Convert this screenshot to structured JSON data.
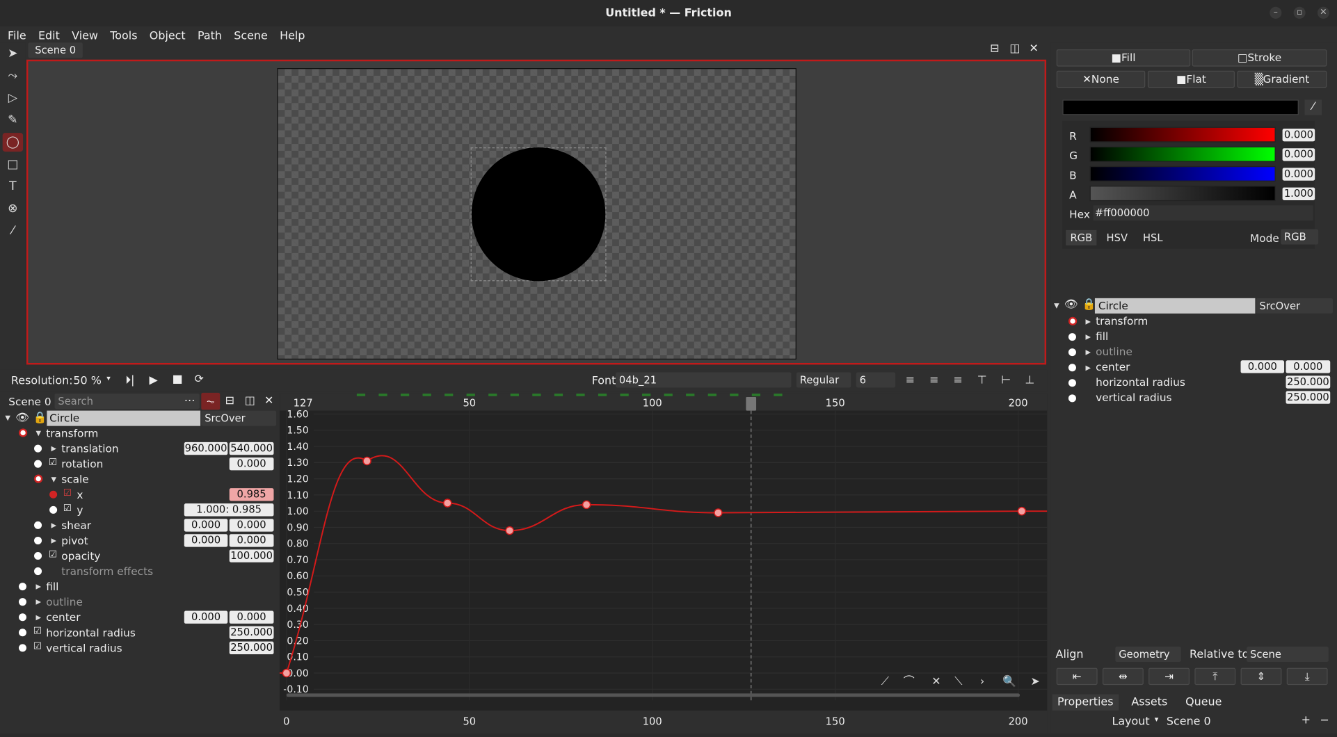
{
  "window": {
    "title": "Untitled * — Friction",
    "min": "–",
    "max": "▫",
    "close": "✕"
  },
  "menu": [
    "File",
    "Edit",
    "View",
    "Tools",
    "Object",
    "Path",
    "Scene",
    "Help"
  ],
  "scene_tab": "Scene 0",
  "controls": {
    "resolution_label": "Resolution:",
    "resolution_value": "50 %",
    "font_label": "Font",
    "font_value": "04b_21",
    "font_style": "Regular",
    "font_size": "6"
  },
  "left": {
    "scene_label": "Scene 0",
    "search_placeholder": "Search",
    "object_name": "Circle",
    "blend": "SrcOver",
    "rows": [
      {
        "label": "transform"
      },
      {
        "label": "translation",
        "v1": "960.000",
        "v2": "540.000"
      },
      {
        "label": "rotation",
        "v1": "0.000"
      },
      {
        "label": "scale"
      },
      {
        "label": "x",
        "v1": "0.985"
      },
      {
        "label": "y",
        "v1": "1.000: 0.985"
      },
      {
        "label": "shear",
        "v1": "0.000",
        "v2": "0.000"
      },
      {
        "label": "pivot",
        "v1": "0.000",
        "v2": "0.000"
      },
      {
        "label": "opacity",
        "v1": "100.000"
      },
      {
        "label": "transform effects"
      },
      {
        "label": "fill"
      },
      {
        "label": "outline"
      },
      {
        "label": "center",
        "v1": "0.000",
        "v2": "0.000"
      },
      {
        "label": "horizontal radius",
        "v1": "250.000"
      },
      {
        "label": "vertical radius",
        "v1": "250.000"
      }
    ]
  },
  "timeline": {
    "start_frame": "127",
    "top_ticks": [
      "50",
      "100",
      "150",
      "200"
    ],
    "bottom_ticks": [
      "0",
      "50",
      "100",
      "150",
      "200"
    ],
    "y_labels": [
      "1.60",
      "1.50",
      "1.40",
      "1.30",
      "1.20",
      "1.10",
      "1.00",
      "0.90",
      "0.80",
      "0.70",
      "0.60",
      "0.50",
      "0.40",
      "0.30",
      "0.20",
      "0.10",
      "0.00",
      "-0.10"
    ]
  },
  "chart_data": {
    "type": "line",
    "x_range": [
      0,
      207
    ],
    "ylim": [
      -0.1,
      1.6
    ],
    "keyframes": [
      {
        "x": 0,
        "y": 0.0
      },
      {
        "x": 22,
        "y": 1.31
      },
      {
        "x": 44,
        "y": 1.05
      },
      {
        "x": 61,
        "y": 0.88
      },
      {
        "x": 82,
        "y": 1.04
      },
      {
        "x": 118,
        "y": 0.99
      },
      {
        "x": 201,
        "y": 1.0
      }
    ],
    "current_frame": 127,
    "line_color": "#d41a1a"
  },
  "right": {
    "fill": "Fill",
    "stroke": "Stroke",
    "none": "None",
    "flat": "Flat",
    "gradient": "Gradient",
    "r": "0.000",
    "g": "0.000",
    "b": "0.000",
    "a": "1.000",
    "hex_label": "Hex",
    "hex": "#ff000000",
    "modes": [
      "RGB",
      "HSV",
      "HSL"
    ],
    "mode_label": "Mode",
    "mode_value": "RGB",
    "object_name": "Circle",
    "blend": "SrcOver",
    "rows": [
      {
        "label": "transform"
      },
      {
        "label": "fill"
      },
      {
        "label": "outline"
      },
      {
        "label": "center",
        "v1": "0.000",
        "v2": "0.000"
      },
      {
        "label": "horizontal radius",
        "v1": "250.000"
      },
      {
        "label": "vertical radius",
        "v1": "250.000"
      }
    ],
    "align_label": "Align",
    "align_value": "Geometry",
    "relative_label": "Relative to",
    "relative_value": "Scene",
    "tabs": [
      "Properties",
      "Assets",
      "Queue"
    ],
    "layout_label": "Layout",
    "layout_value": "Scene 0"
  }
}
